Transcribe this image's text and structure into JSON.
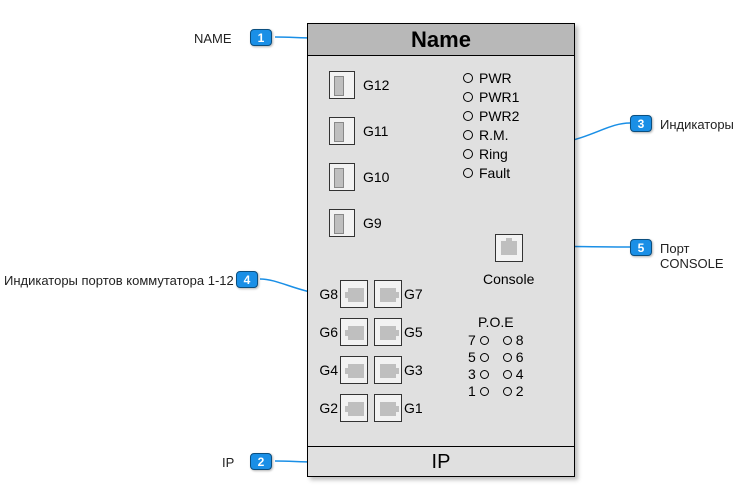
{
  "device": {
    "title": "Name",
    "ip": "IP",
    "sfp_ports": [
      "G12",
      "G11",
      "G10",
      "G9"
    ],
    "indicators": [
      "PWR",
      "PWR1",
      "PWR2",
      "R.M.",
      "Ring",
      "Fault"
    ],
    "console_label": "Console",
    "rj_pairs": [
      {
        "left": "G8",
        "right": "G7"
      },
      {
        "left": "G6",
        "right": "G5"
      },
      {
        "left": "G4",
        "right": "G3"
      },
      {
        "left": "G2",
        "right": "G1"
      }
    ],
    "poe": {
      "title": "P.O.E",
      "rows": [
        {
          "l": "7",
          "r": "8"
        },
        {
          "l": "5",
          "r": "6"
        },
        {
          "l": "3",
          "r": "4"
        },
        {
          "l": "1",
          "r": "2"
        }
      ]
    }
  },
  "callouts": {
    "c1": {
      "num": "1",
      "text": "NAME"
    },
    "c2": {
      "num": "2",
      "text": "IP"
    },
    "c3": {
      "num": "3",
      "text": "Индикаторы"
    },
    "c4": {
      "num": "4",
      "text": "Индикаторы портов коммутатора 1-12"
    },
    "c5": {
      "num": "5",
      "text": "Порт CONSOLE"
    }
  }
}
